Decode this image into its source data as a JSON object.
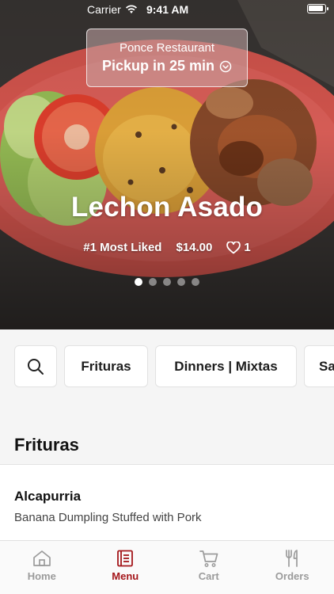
{
  "status_bar": {
    "carrier": "Carrier",
    "time": "9:41 AM"
  },
  "pickup": {
    "restaurant": "Ponce Restaurant",
    "eta": "Pickup in 25 min"
  },
  "hero": {
    "dish_name": "Lechon Asado",
    "rank": "#1 Most Liked",
    "price": "$14.00",
    "likes": "1",
    "slide_count": 5,
    "active_slide": 0
  },
  "categories": [
    "Frituras",
    "Dinners | Mixtas",
    "Sa"
  ],
  "section": {
    "title": "Frituras"
  },
  "items": [
    {
      "name": "Alcapurria",
      "description": "Banana Dumpling Stuffed with Pork"
    }
  ],
  "tabs": [
    {
      "label": "Home",
      "icon": "home-icon"
    },
    {
      "label": "Menu",
      "icon": "menu-book-icon"
    },
    {
      "label": "Cart",
      "icon": "cart-icon"
    },
    {
      "label": "Orders",
      "icon": "fork-knife-icon"
    }
  ],
  "colors": {
    "accent": "#a4161a",
    "tab_inactive": "#9b9b9b",
    "background": "#f5f5f5"
  }
}
